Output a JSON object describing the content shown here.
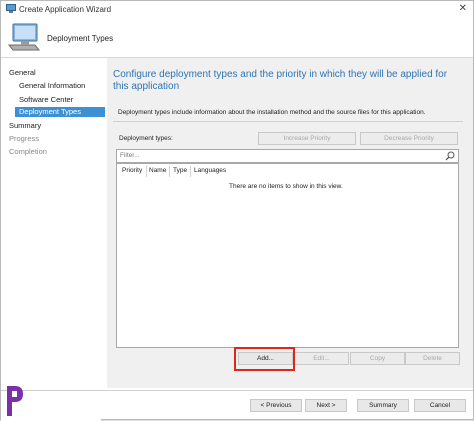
{
  "window": {
    "title": "Create Application Wizard",
    "close_symbol": "✕"
  },
  "banner": {
    "title": "Deployment Types"
  },
  "nav": {
    "items": [
      {
        "label": "General",
        "level": 0,
        "state": "normal"
      },
      {
        "label": "General Information",
        "level": 1,
        "state": "normal"
      },
      {
        "label": "Software Center",
        "level": 1,
        "state": "normal"
      },
      {
        "label": "Deployment Types",
        "level": 1,
        "state": "selected"
      },
      {
        "label": "Summary",
        "level": 0,
        "state": "normal"
      },
      {
        "label": "Progress",
        "level": 0,
        "state": "dim"
      },
      {
        "label": "Completion",
        "level": 0,
        "state": "dim"
      }
    ]
  },
  "main": {
    "heading": "Configure deployment types and the priority in which they will be applied for this application",
    "description": "Deployment types include information about the installation method and the source files for this application.",
    "deployment_types_label": "Deployment types:",
    "increase_priority": "Increase Priority",
    "decrease_priority": "Decrease Priority",
    "filter_placeholder": "Filter...",
    "columns": [
      "Priority",
      "Name",
      "Type",
      "Languages"
    ],
    "empty_message": "There are no items to show in this view.",
    "add": "Add...",
    "edit": "Edit...",
    "copy": "Copy",
    "delete": "Delete"
  },
  "footer": {
    "previous": "< Previous",
    "next": "Next >",
    "summary": "Summary",
    "cancel": "Cancel"
  },
  "colors": {
    "accent": "#2e74b5",
    "selection": "#3d90d6",
    "highlight": "#e0261a"
  }
}
